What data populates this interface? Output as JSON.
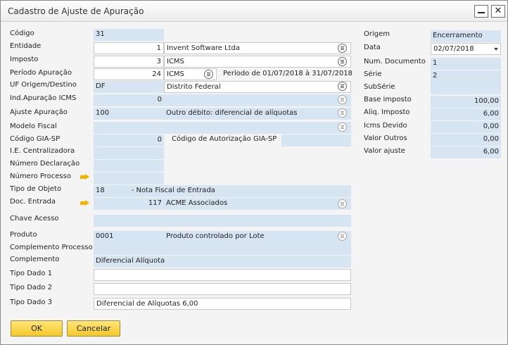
{
  "window": {
    "title": "Cadastro de Ajuste de Apuração"
  },
  "labels": {
    "codigo": "Código",
    "entidade": "Entidade",
    "imposto": "Imposto",
    "periodo": "Período Apuração",
    "uf": "UF Origem/Destino",
    "ind_apuracao": "Ind.Apuração ICMS",
    "ajuste": "Ajuste Apuração",
    "modelo": "Modelo Fiscal",
    "codigo_gia": "Código GIA-SP",
    "cod_autorizacao": "Código de Autorização GIA-SP",
    "ie": "I.E. Centralizadora",
    "num_declaracao": "Número Declaração",
    "num_processo": "Número Processo",
    "tipo_objeto": "Tipo de Objeto",
    "doc_entrada": "Doc. Entrada",
    "chave": "Chave Acesso",
    "produto": "Produto",
    "compl_processo": "Complemento Processo",
    "complemento": "Complemento",
    "tipo1": "Tipo Dado 1",
    "tipo2": "Tipo Dado 2",
    "tipo3": "Tipo Dado 3",
    "origem": "Origem",
    "data": "Data",
    "num_doc": "Num. Documento",
    "serie": "Série",
    "subserie": "SubSérie",
    "base": "Base imposto",
    "aliq": "Aliq. Imposto",
    "icms_devido": "Icms Devido",
    "valor_outros": "Valor Outros",
    "valor_ajuste": "Valor ajuste"
  },
  "fields": {
    "codigo": "31",
    "entidade_num": "1",
    "entidade_nome": "Invent Software Ltda",
    "imposto_num": "3",
    "imposto_nome": "ICMS",
    "periodo_num": "24",
    "periodo_nome": "ICMS",
    "periodo_desc": "Período de 01/07/2018 à 31/07/2018",
    "uf_cod": "DF",
    "uf_nome": "Distrito Federal",
    "ind_apuracao": "0",
    "ajuste_cod": "100",
    "ajuste_desc": "Outro débito: diferencial de alíquotas",
    "codigo_gia": "0",
    "tipo_objeto_cod": "18",
    "tipo_objeto_desc": "- Nota Fiscal de Entrada",
    "doc_entrada_num": "117",
    "doc_entrada_nome": "ACME Associados",
    "produto_cod": "0001",
    "produto_desc": "Produto controlado por Lote",
    "complemento": "Diferencial Alíquota",
    "tipo3": "Diferencial de Alíquotas 6,00",
    "origem": "Encerramento",
    "data": "02/07/2018",
    "num_doc": "1",
    "serie": "2",
    "base": "100,00",
    "aliq": "6,00",
    "icms_devido": "0,00",
    "valor_outros": "0,00",
    "valor_ajuste": "6,00"
  },
  "buttons": {
    "ok": "OK",
    "cancel": "Cancelar"
  },
  "colors": {
    "field_bg": "#d7e4f2",
    "button_bg": "#f5c92a",
    "link_arrow": "#f0b400"
  }
}
